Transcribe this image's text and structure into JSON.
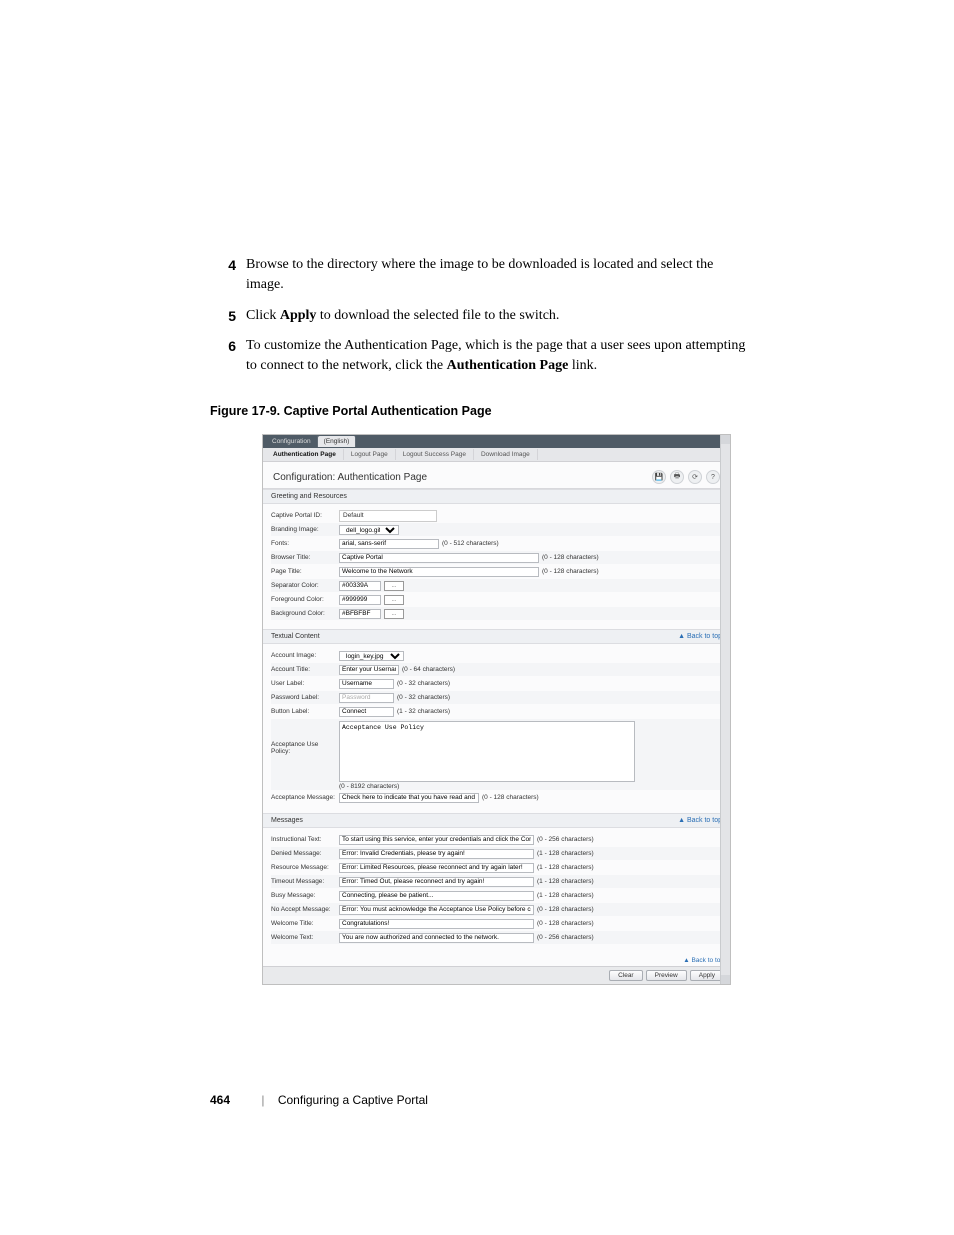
{
  "steps": [
    {
      "num": "4",
      "text_a": "Browse to the directory where the image to be downloaded is located and select the image."
    },
    {
      "num": "5",
      "text_a": "Click ",
      "bold1": "Apply",
      "text_b": " to download the selected file to the switch."
    },
    {
      "num": "6",
      "text_a": "To customize the Authentication Page, which is the page that a user sees upon attempting to connect to the network, click the ",
      "bold1": "Authentication Page",
      "text_b": " link."
    }
  ],
  "figure_caption": "Figure 17-9.    Captive Portal Authentication Page",
  "shot": {
    "tabs1": {
      "a": "Configuration",
      "b": "(English)"
    },
    "tabs2": {
      "a": "Authentication Page",
      "b": "Logout Page",
      "c": "Logout Success Page",
      "d": "Download Image"
    },
    "title": "Configuration: Authentication Page",
    "sections": {
      "greeting": "Greeting and Resources",
      "textual": "Textual Content",
      "messages": "Messages",
      "backtop": "▲ Back to top"
    },
    "greeting_rows": {
      "captive_id_label": "Captive Portal ID:",
      "captive_id_value": "Default",
      "branding_label": "Branding Image:",
      "branding_value": "dell_logo.gif",
      "fonts_label": "Fonts:",
      "fonts_value": "arial, sans-serif",
      "fonts_hint": "(0 - 512 characters)",
      "browser_title_label": "Browser Title:",
      "browser_title_value": "Captive Portal",
      "browser_title_hint": "(0 - 128 characters)",
      "page_title_label": "Page Title:",
      "page_title_value": "Welcome to the Network",
      "page_title_hint": "(0 - 128 characters)",
      "sep_color_label": "Separator Color:",
      "sep_color_value": "#00339A",
      "fg_color_label": "Foreground Color:",
      "fg_color_value": "#999999",
      "bg_color_label": "Background Color:",
      "bg_color_value": "#BFBFBF"
    },
    "textual_rows": {
      "account_image_label": "Account Image:",
      "account_image_value": "login_key.jpg",
      "account_title_label": "Account Title:",
      "account_title_value": "Enter your Username",
      "account_title_hint": "(0 - 64 characters)",
      "user_label_label": "User Label:",
      "user_label_value": "Username",
      "user_label_hint": "(0 - 32 characters)",
      "password_label_label": "Password Label:",
      "password_label_value": "Password",
      "password_label_hint": "(0 - 32 characters)",
      "button_label_label": "Button Label:",
      "button_label_value": "Connect",
      "button_label_hint": "(1 - 32 characters)",
      "policy_label": "Acceptance Use Policy:",
      "policy_value": "Acceptance Use Policy",
      "policy_hint": "(0 - 8192 characters)",
      "accept_msg_label": "Acceptance Message:",
      "accept_msg_value": "Check here to indicate that you have read and accepte",
      "accept_msg_hint": "(0 - 128 characters)"
    },
    "message_rows": {
      "instructional_label": "Instructional Text:",
      "instructional_value": "To start using this service, enter your credentials and click the Connect bu",
      "instructional_hint": "(0 - 256 characters)",
      "denied_label": "Denied Message:",
      "denied_value": "Error: Invalid Credentials, please try again!",
      "denied_hint": "(1 - 128 characters)",
      "resource_label": "Resource Message:",
      "resource_value": "Error: Limited Resources, please reconnect and try again later!",
      "resource_hint": "(1 - 128 characters)",
      "timeout_label": "Timeout Message:",
      "timeout_value": "Error: Timed Out, please reconnect and try again!",
      "timeout_hint": "(1 - 128 characters)",
      "busy_label": "Busy Message:",
      "busy_value": "Connecting, please be patient...",
      "busy_hint": "(1 - 128 characters)",
      "noaccept_label": "No Accept Message:",
      "noaccept_value": "Error: You must acknowledge the Acceptance Use Policy before connectin",
      "noaccept_hint": "(0 - 128 characters)",
      "welcome_title_label": "Welcome Title:",
      "welcome_title_value": "Congratulations!",
      "welcome_title_hint": "(0 - 128 characters)",
      "welcome_text_label": "Welcome Text:",
      "welcome_text_value": "You are now authorized and connected to the network.",
      "welcome_text_hint": "(0 - 256 characters)"
    },
    "buttons": {
      "clear": "Clear",
      "preview": "Preview",
      "apply": "Apply"
    }
  },
  "footer": {
    "page_num": "464",
    "section": "Configuring a Captive Portal"
  }
}
